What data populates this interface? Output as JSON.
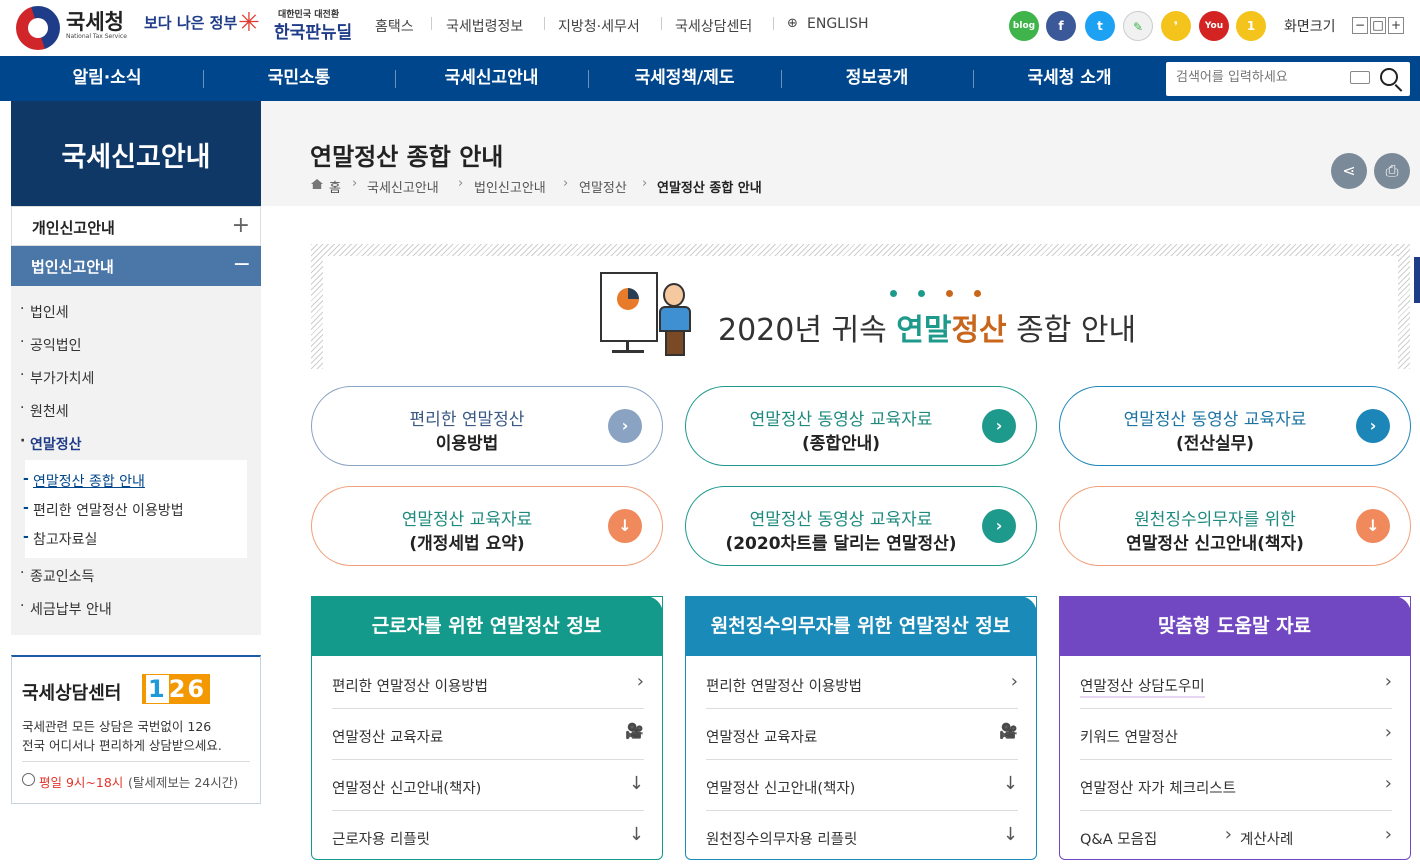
{
  "header": {
    "logo_name": "국세청",
    "logo_sub": "National Tax Service",
    "better_gov": "보다 나은 정부",
    "korean_new_deal_small": "대한민국 대전환",
    "korean_new_deal": "한국판뉴딜",
    "util_links": [
      "홈택스",
      "국세법령정보",
      "지방청·세무서",
      "국세상담센터",
      "ENGLISH"
    ],
    "sns": [
      {
        "name": "blog",
        "label": "blog",
        "color": "#3eb44a"
      },
      {
        "name": "facebook",
        "label": "f",
        "color": "#3b5998"
      },
      {
        "name": "twitter",
        "label": "t",
        "color": "#1da1f2"
      },
      {
        "name": "post",
        "label": "✎",
        "color": "#f1f1f1"
      },
      {
        "name": "kakao-story",
        "label": "❜",
        "color": "#f4c31c"
      },
      {
        "name": "youtube",
        "label": "You",
        "color": "#d32323"
      },
      {
        "name": "one",
        "label": "1",
        "color": "#f4c31c"
      }
    ],
    "font_size_label": "화면크기",
    "font_btns": [
      "−",
      "□",
      "+"
    ]
  },
  "gnb": {
    "items": [
      "알림·소식",
      "국민소통",
      "국세신고안내",
      "국세정책/제도",
      "정보공개",
      "국세청 소개"
    ],
    "search_placeholder": "검색어를 입력하세요"
  },
  "lnb": {
    "title": "국세신고안내",
    "depth1": [
      {
        "label": "개인신고안내",
        "symbol": "+"
      },
      {
        "label": "법인신고안내",
        "symbol": "−"
      }
    ],
    "items": [
      "법인세",
      "공익법인",
      "부가가치세",
      "원천세",
      "연말정산",
      "종교인소득",
      "세금납부 안내"
    ],
    "subs": [
      "연말정산 종합 안내",
      "편리한 연말정산 이용방법",
      "참고자료실"
    ]
  },
  "consult": {
    "title": "국세상담센터",
    "number_first": "1",
    "number_rest": "26",
    "desc1": "국세관련 모든 상담은 국번없이 126",
    "desc2": "전국 어디서나 편리하게 상담받으세요.",
    "hours": "평일 9시~18시",
    "hours_note": "(탈세제보는 24시간)"
  },
  "content": {
    "title": "연말정산 종합 안내",
    "breadcrumb": [
      "홈",
      "국세신고안내",
      "법인신고안내",
      "연말정산",
      "연말정산 종합 안내"
    ],
    "hero_prefix": "2020년 귀속 ",
    "hero_green": "연말",
    "hero_orange": "정산",
    "hero_suffix": " 종합 안내",
    "dot_colors": [
      "#1e9a8c",
      "#1e9a8c",
      "#c8661c",
      "#c8661c"
    ]
  },
  "quick": [
    {
      "l1": "편리한 연말정산",
      "l2": "이용방법",
      "color": "#8aa3c2",
      "border": "#8aa3c2",
      "text": "#3a5a85",
      "icon": "›"
    },
    {
      "l1": "연말정산 동영상 교육자료",
      "l2": "(종합안내)",
      "color": "#1e9a8c",
      "border": "#1e9a8c",
      "text": "#1e8a7e",
      "icon": "›"
    },
    {
      "l1": "연말정산 동영상 교육자료",
      "l2": "(전산실무)",
      "color": "#1d86b9",
      "border": "#1d86b9",
      "text": "#1d74a3",
      "icon": "›"
    },
    {
      "l1": "연말정산 교육자료",
      "l2": "(개정세법 요약)",
      "color": "#f08a5d",
      "border": "#f0a07a",
      "text": "#1e8a7e",
      "icon": "↓"
    },
    {
      "l1": "연말정산 동영상 교육자료",
      "l2": "(2020차트를 달리는 연말정산)",
      "color": "#1e9a8c",
      "border": "#1e9a8c",
      "text": "#1e8a7e",
      "icon": "›"
    },
    {
      "l1": "원천징수의무자를 위한",
      "l2": "연말정산 신고안내(책자)",
      "color": "#f08a5d",
      "border": "#f0a07a",
      "text": "#1e8a7e",
      "icon": "↓"
    }
  ],
  "panels": [
    {
      "title": "근로자를 위한 연말정산 정보",
      "color": "#139a8b",
      "rows": [
        {
          "label": "편리한 연말정산 이용방법",
          "icon": "›"
        },
        {
          "label": "연말정산 교육자료",
          "icon": "🎥"
        },
        {
          "label": "연말정산 신고안내(책자)",
          "icon": "↓"
        },
        {
          "label": "근로자용 리플릿",
          "icon": "↓"
        }
      ]
    },
    {
      "title": "원천징수의무자를 위한 연말정산 정보",
      "color": "#1a8ab8",
      "rows": [
        {
          "label": "편리한 연말정산 이용방법",
          "icon": "›"
        },
        {
          "label": "연말정산 교육자료",
          "icon": "🎥"
        },
        {
          "label": "연말정산 신고안내(책자)",
          "icon": "↓"
        },
        {
          "label": "원천징수의무자용 리플릿",
          "icon": "↓"
        }
      ]
    },
    {
      "title": "맞춤형 도움말 자료",
      "color": "#7148c1",
      "rows": [
        {
          "label": "연말정산 상담도우미",
          "icon": "›"
        },
        {
          "label": "키워드 연말정산",
          "icon": "›"
        },
        {
          "label": "연말정산 자가 체크리스트",
          "icon": "›"
        },
        {
          "label": "Q&A 모음집",
          "icon": "›"
        }
      ],
      "extra": "계산사례"
    }
  ]
}
